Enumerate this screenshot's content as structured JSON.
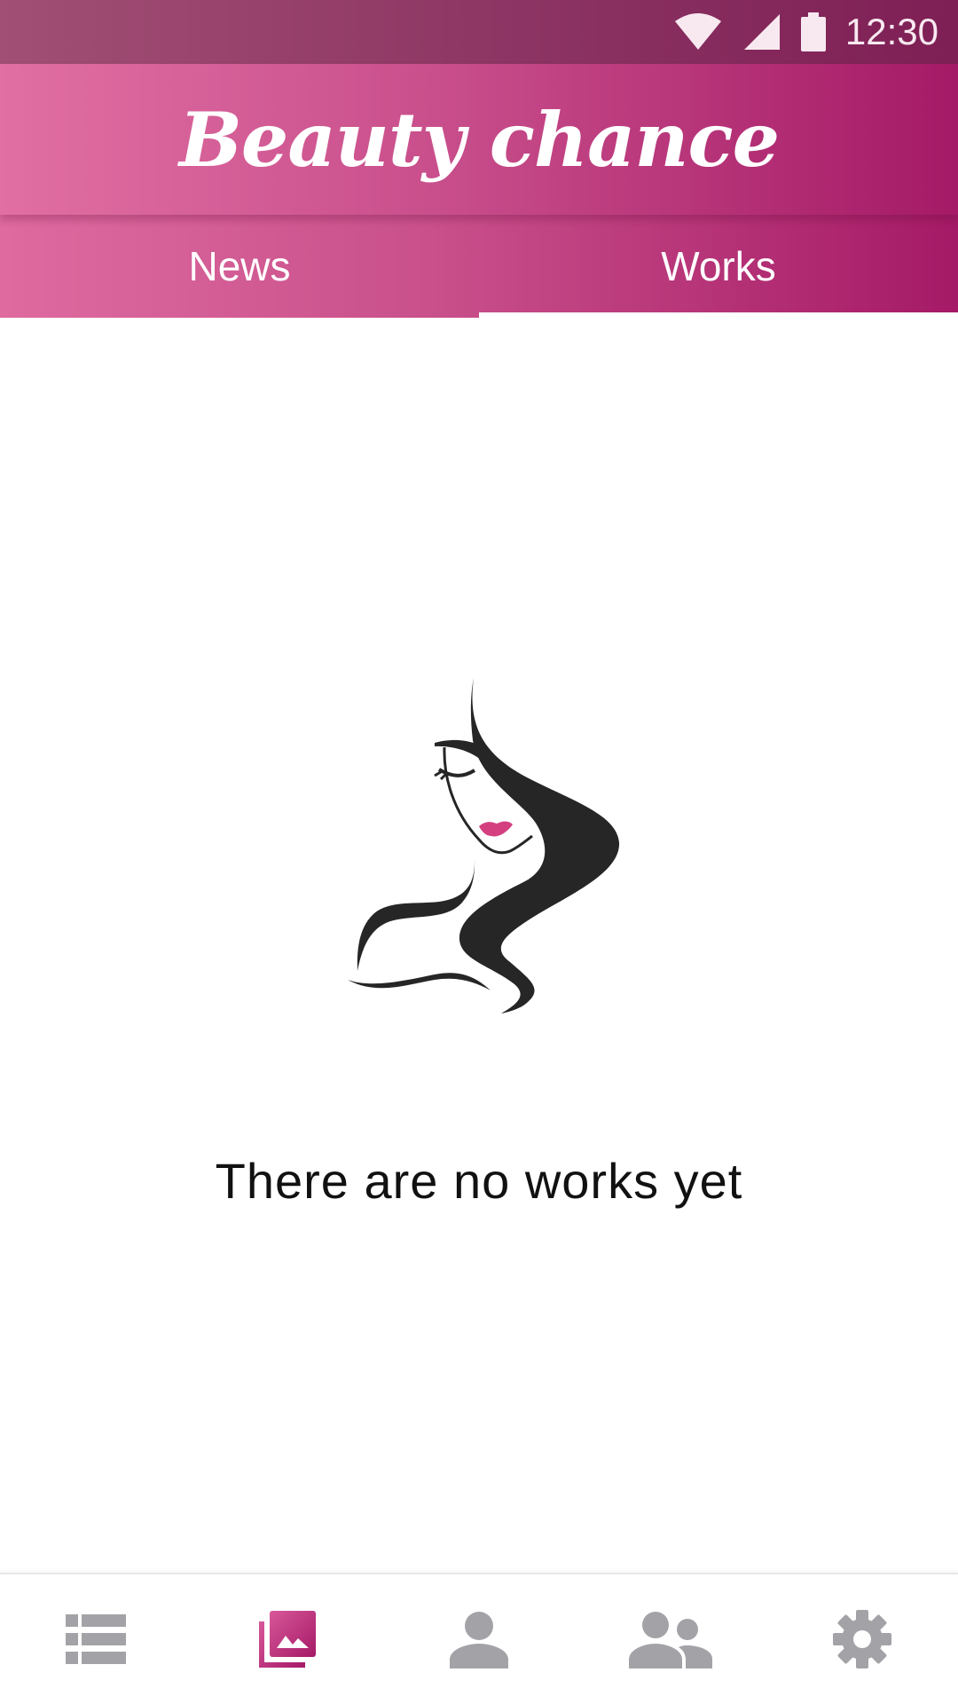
{
  "status_bar": {
    "time": "12:30",
    "icons": [
      "wifi-icon",
      "cellular-signal-icon",
      "battery-icon"
    ],
    "color": "#f8e9f0"
  },
  "app_bar": {
    "title": "Beauty chance"
  },
  "tabs": [
    {
      "label": "News",
      "selected": false
    },
    {
      "label": "Works",
      "selected": true
    }
  ],
  "empty_state": {
    "illustration": "woman-face-logo",
    "message": "There are no works yet"
  },
  "bottom_nav": {
    "items": [
      {
        "icon": "list-icon",
        "active": false
      },
      {
        "icon": "gallery-icon",
        "active": true
      },
      {
        "icon": "person-icon",
        "active": false
      },
      {
        "icon": "people-icon",
        "active": false
      },
      {
        "icon": "settings-gear-icon",
        "active": false
      }
    ],
    "active_color": "#c23f86",
    "inactive_color": "#a3a3a7"
  },
  "colors": {
    "brand_pink": "#d6589a",
    "brand_magenta": "#a51a66",
    "lips": "#d4407f",
    "hair": "#262626"
  }
}
